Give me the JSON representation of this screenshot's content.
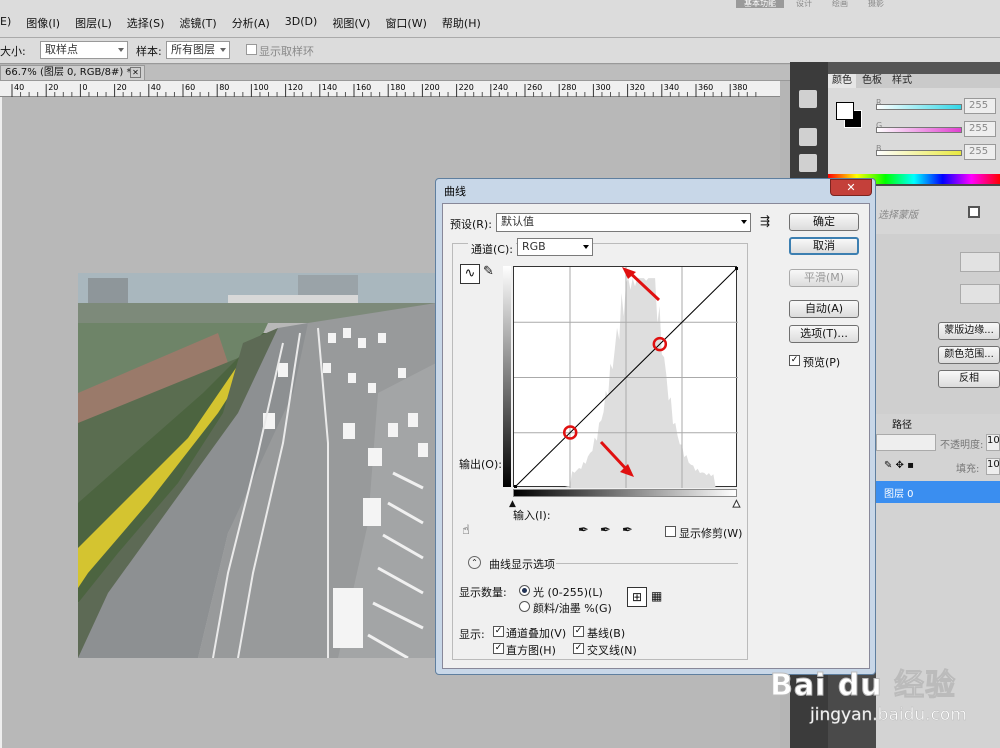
{
  "menubar": {
    "items": [
      "E)",
      "图像(I)",
      "图层(L)",
      "选择(S)",
      "滤镜(T)",
      "分析(A)",
      "3D(D)",
      "视图(V)",
      "窗口(W)",
      "帮助(H)"
    ],
    "workspace": [
      "基本功能",
      "设计",
      "绘画",
      "摄影"
    ]
  },
  "options": {
    "size_label": "大小:",
    "sample_size_value": "取样点",
    "sample_label": "样本:",
    "sample_value": "所有图层",
    "show_ring_label": "显示取样环"
  },
  "document": {
    "tab_title": "66.7% (图层 0, RGB/8#) *",
    "ruler_ticks": [
      "40",
      "20",
      "0",
      "20",
      "40",
      "60",
      "80",
      "100",
      "120",
      "140",
      "160",
      "180",
      "200",
      "220",
      "240",
      "260",
      "280",
      "300",
      "320",
      "340",
      "360",
      "380"
    ]
  },
  "color_panel": {
    "tabs": [
      "颜色",
      "色板",
      "样式"
    ],
    "channels": [
      {
        "name": "R",
        "value": "255",
        "color": "#33d6e6"
      },
      {
        "name": "G",
        "value": "255",
        "color": "#e040d0"
      },
      {
        "name": "B",
        "value": "255",
        "color": "#e8e840"
      }
    ]
  },
  "right_panel": {
    "mask_edge": "蒙版边缘...",
    "color_range": "颜色范围...",
    "invert": "反相",
    "paths_tab": "路径",
    "opacity_label": "不透明度:",
    "opacity_value": "10",
    "fill_label": "填充:",
    "fill_value": "10",
    "layer_name": "图层 0",
    "partial_label": "选择蒙版"
  },
  "curves": {
    "title": "曲线",
    "close": "✕",
    "preset_label": "预设(R):",
    "preset_value": "默认值",
    "channel_label": "通道(C):",
    "channel_value": "RGB",
    "output_label": "输出(O):",
    "input_label": "输入(I):",
    "show_clipping": "显示修剪(W)",
    "curve_display_options": "曲线显示选项",
    "show_amount_label": "显示数量:",
    "light_option": "光 (0-255)(L)",
    "pigment_option": "颜料/油墨 %(G)",
    "show_label": "显示:",
    "channel_overlays": "通道叠加(V)",
    "baseline": "基线(B)",
    "histogram": "直方图(H)",
    "intersection_line": "交叉线(N)",
    "buttons": {
      "ok": "确定",
      "cancel": "取消",
      "smooth": "平滑(M)",
      "auto": "自动(A)",
      "options": "选项(T)...",
      "preview": "预览(P)"
    },
    "control_points": [
      {
        "input": 64,
        "output": 64
      },
      {
        "input": 166,
        "output": 166
      }
    ],
    "annotation_color": "#e01010"
  },
  "watermark": {
    "brand": "Bai du 经验",
    "url": "jingyan.baidu.com"
  }
}
